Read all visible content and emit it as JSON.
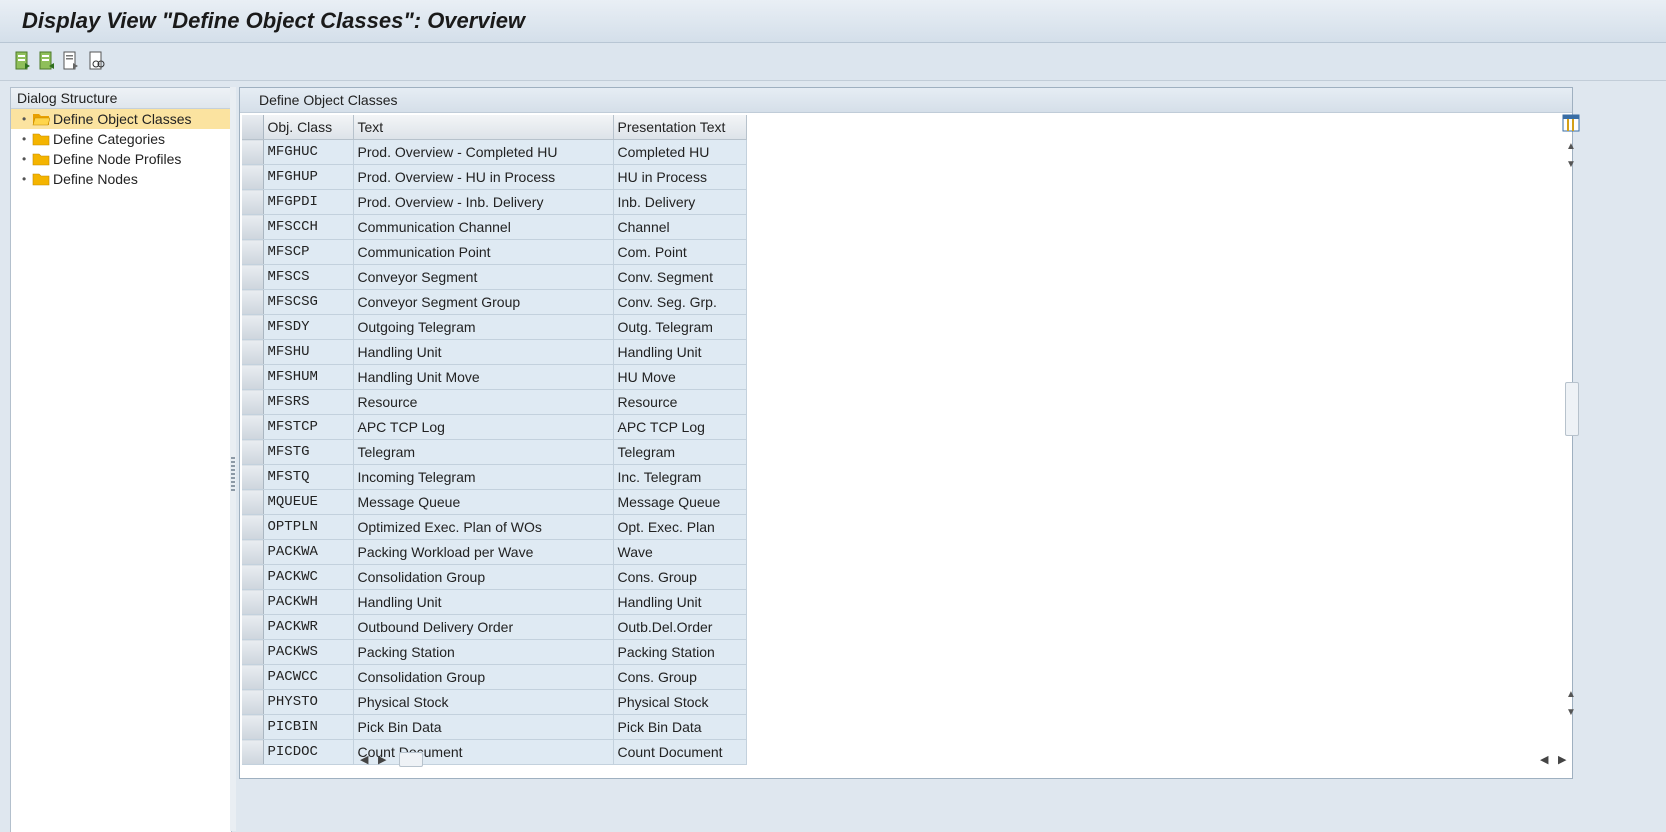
{
  "title": "Display View \"Define Object Classes\": Overview",
  "toolbar": {
    "buttons": [
      "export-icon",
      "import-icon",
      "document-edit-icon",
      "find-icon"
    ]
  },
  "dialog": {
    "header": "Dialog Structure",
    "items": [
      {
        "label": "Define Object Classes",
        "selected": true
      },
      {
        "label": "Define Categories",
        "selected": false
      },
      {
        "label": "Define Node Profiles",
        "selected": false
      },
      {
        "label": "Define Nodes",
        "selected": false
      }
    ]
  },
  "table": {
    "title": "Define Object Classes",
    "columns": [
      "Obj. Class",
      "Text",
      "Presentation Text"
    ],
    "rows": [
      [
        "MFGHUC",
        "Prod. Overview - Completed HU",
        "Completed HU"
      ],
      [
        "MFGHUP",
        "Prod. Overview - HU in Process",
        "HU in Process"
      ],
      [
        "MFGPDI",
        "Prod. Overview - Inb. Delivery",
        "Inb. Delivery"
      ],
      [
        "MFSCCH",
        "Communication Channel",
        "Channel"
      ],
      [
        "MFSCP",
        "Communication Point",
        "Com. Point"
      ],
      [
        "MFSCS",
        "Conveyor Segment",
        "Conv. Segment"
      ],
      [
        "MFSCSG",
        "Conveyor Segment Group",
        "Conv. Seg. Grp."
      ],
      [
        "MFSDY",
        "Outgoing Telegram",
        "Outg. Telegram"
      ],
      [
        "MFSHU",
        "Handling Unit",
        "Handling Unit"
      ],
      [
        "MFSHUM",
        "Handling Unit Move",
        "HU Move"
      ],
      [
        "MFSRS",
        "Resource",
        "Resource"
      ],
      [
        "MFSTCP",
        "APC TCP Log",
        "APC TCP Log"
      ],
      [
        "MFSTG",
        "Telegram",
        "Telegram"
      ],
      [
        "MFSTQ",
        "Incoming Telegram",
        "Inc. Telegram"
      ],
      [
        "MQUEUE",
        "Message Queue",
        "Message Queue"
      ],
      [
        "OPTPLN",
        "Optimized Exec. Plan of WOs",
        "Opt. Exec. Plan"
      ],
      [
        "PACKWA",
        "Packing Workload per Wave",
        "Wave"
      ],
      [
        "PACKWC",
        "Consolidation Group",
        "Cons. Group"
      ],
      [
        "PACKWH",
        "Handling Unit",
        "Handling Unit"
      ],
      [
        "PACKWR",
        "Outbound Delivery Order",
        "Outb.Del.Order"
      ],
      [
        "PACKWS",
        "Packing Station",
        "Packing Station"
      ],
      [
        "PACWCC",
        "Consolidation Group",
        "Cons. Group"
      ],
      [
        "PHYSTO",
        "Physical Stock",
        "Physical Stock"
      ],
      [
        "PICBIN",
        "Pick Bin Data",
        "Pick Bin Data"
      ],
      [
        "PICDOC",
        "Count Document",
        "Count Document"
      ]
    ]
  },
  "colors": {
    "row_bg": "#dfeaf3",
    "selected_tree": "#fbe3a0",
    "folder": "#f4b400"
  }
}
